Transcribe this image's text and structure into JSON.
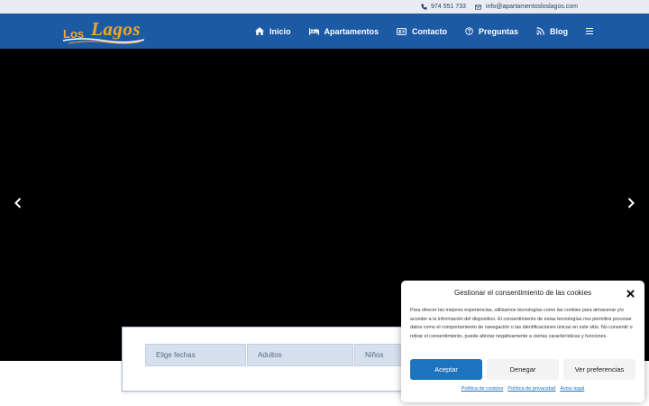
{
  "topbar": {
    "phone": "974 551 733",
    "email": "info@apartamentosloslagos.com"
  },
  "logo": {
    "prefix": "Los",
    "name": "Lagos",
    "accent_color": "#f5a623"
  },
  "nav": {
    "background": "#1d5aa6",
    "items": [
      {
        "label": "Inicio",
        "icon": "home-icon"
      },
      {
        "label": "Apartamentos",
        "icon": "bed-icon"
      },
      {
        "label": "Contacto",
        "icon": "id-card-icon"
      },
      {
        "label": "Preguntas",
        "icon": "question-circle-icon"
      },
      {
        "label": "Blog",
        "icon": "rss-icon"
      }
    ],
    "menu_icon": "hamburger-menu-icon"
  },
  "hero": {
    "prev_icon": "chevron-left-icon",
    "next_icon": "chevron-right-icon"
  },
  "booking": {
    "dates_placeholder": "Elige fechas",
    "adults_placeholder": "Adultos",
    "kids_placeholder": "Niños"
  },
  "cookie": {
    "title": "Gestionar el consentimiento de las cookies",
    "body": "Para ofrecer las mejores experiencias, utilizamos tecnologías como las cookies para almacenar y/o acceder a la información del dispositivo. El consentimiento de estas tecnologías nos permitirá procesar datos como el comportamiento de navegación o las identificaciones únicas en este sitio. No consentir o retirar el consentimiento, puede afectar negativamente a ciertas características y funciones.",
    "accept": "Aceptar",
    "deny": "Denegar",
    "preferences": "Ver preferencias",
    "links": [
      "Política de cookies",
      "Política de privacidad",
      "Aviso legal"
    ],
    "accent_color": "#1e73be"
  }
}
